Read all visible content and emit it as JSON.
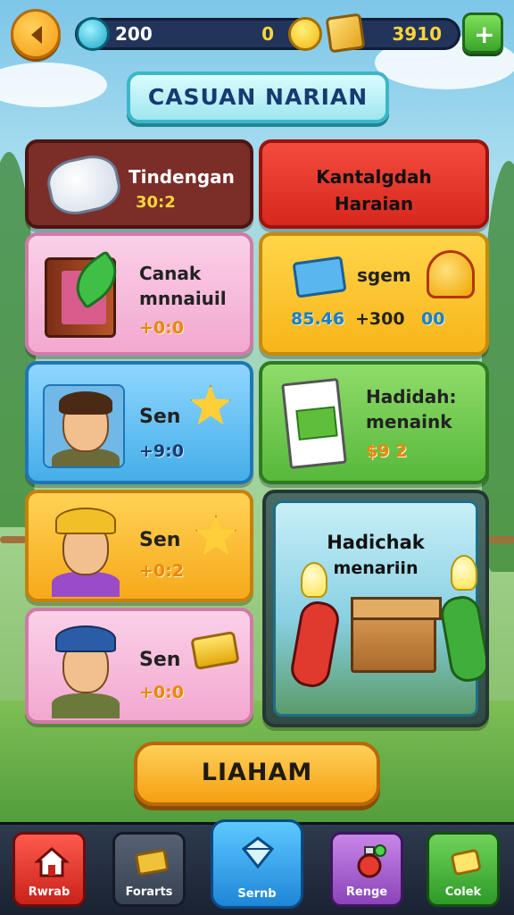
{
  "top_bar": {
    "gems": "200",
    "coins": "0",
    "tickets": "3910",
    "add_label": "+"
  },
  "title": "CASUAN NARIAN",
  "cards": {
    "daily": {
      "title": "Tindengan",
      "points": "30:2"
    },
    "category": {
      "line1": "Kantalgdah",
      "line2": "Haraian"
    },
    "task1": {
      "line1": "Canak",
      "line2": "mnnaiuil",
      "points": "+0:0"
    },
    "task2": {
      "title": "sgem",
      "value1": "85.46",
      "value2": "+300",
      "value3": "00"
    },
    "task3": {
      "title": "Sen",
      "points": "+9:0"
    },
    "reward1": {
      "line1": "Hadidah:",
      "line2": "menaink",
      "points": "$9 2"
    },
    "task4": {
      "title": "Sen",
      "points": "+0:2"
    },
    "task5": {
      "title": "Sen",
      "points": "+0:0"
    },
    "feature": {
      "line1": "Hadichak",
      "line2": "menariin"
    }
  },
  "claim_label": "LIAHAM",
  "nav": [
    {
      "label": "Rwrab",
      "icon": "home-icon"
    },
    {
      "label": "Forarts",
      "icon": "ticket-icon"
    },
    {
      "label": "Sernb",
      "icon": "gem-icon"
    },
    {
      "label": "Renge",
      "icon": "potion-icon"
    },
    {
      "label": "Colek",
      "icon": "gold-icon"
    }
  ],
  "colors": {
    "primary_orange": "#f59f12",
    "title_teal": "#3cb7c7",
    "nav_bg": "#1a2232"
  }
}
